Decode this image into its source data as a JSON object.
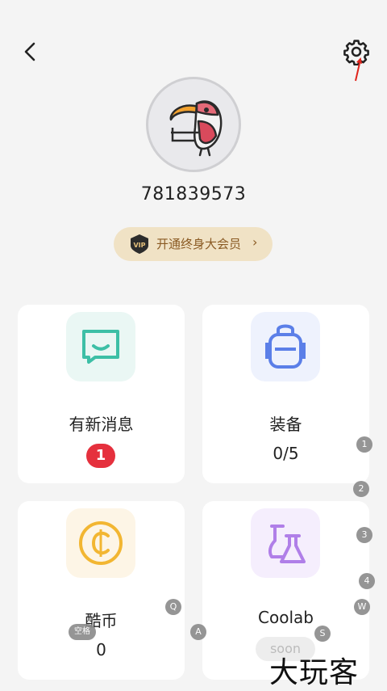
{
  "header": {
    "back_icon": "chevron-left-icon",
    "settings_icon": "gear-icon"
  },
  "profile": {
    "user_id": "781839573",
    "avatar": "toucan-avatar"
  },
  "vip": {
    "badge_text": "VIP",
    "label": "开通终身大会员",
    "chevron": "›",
    "color": "#8a5a23",
    "bg": "#f0e2c5"
  },
  "cards": [
    {
      "title": "有新消息",
      "badge": "1",
      "icon": "message-icon",
      "tile_color": "#eaf7f4",
      "icon_color": "#3dbfa6"
    },
    {
      "title": "装备",
      "value": "0/5",
      "icon": "backpack-icon",
      "tile_color": "#eef2fd",
      "icon_color": "#5b7fe8"
    },
    {
      "title": "酷币",
      "value": "0",
      "icon": "coin-icon",
      "tile_color": "#fdf5e6",
      "icon_color": "#f2b632"
    },
    {
      "title": "Coolab",
      "badge": "soon",
      "icon": "flask-icon",
      "tile_color": "#f5eefd",
      "icon_color": "#b07fe8"
    }
  ],
  "overlay_keys": [
    "1",
    "2",
    "3",
    "4",
    "W",
    "S",
    "Q",
    "A",
    "空格"
  ],
  "watermark": "大玩客"
}
